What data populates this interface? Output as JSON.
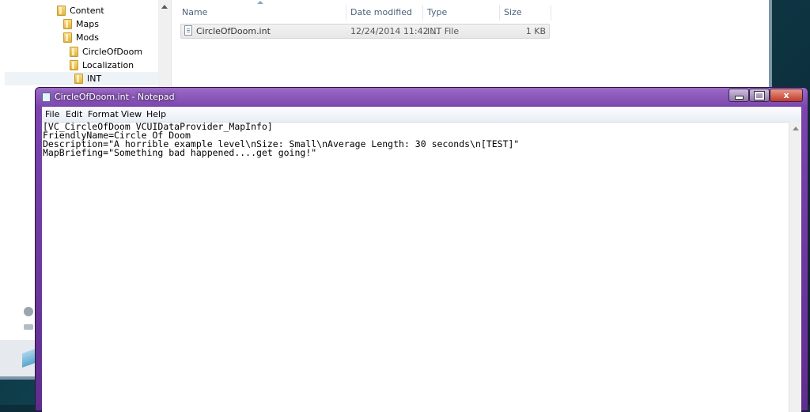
{
  "explorer": {
    "tree": [
      {
        "label": "Content",
        "indent": 0
      },
      {
        "label": "Maps",
        "indent": 1
      },
      {
        "label": "Mods",
        "indent": 1
      },
      {
        "label": "CircleOfDoom",
        "indent": 2
      },
      {
        "label": "Localization",
        "indent": 2
      },
      {
        "label": "INT",
        "indent": 3
      }
    ],
    "columns": {
      "name": "Name",
      "date_modified": "Date modified",
      "type": "Type",
      "size": "Size"
    },
    "file": {
      "name": "CircleOfDoom.int",
      "date_modified": "12/24/2014 11:42 ...",
      "type": "INT File",
      "size": "1 KB"
    }
  },
  "notepad": {
    "title": "CircleOfDoom.int - Notepad",
    "menu": [
      "File",
      "Edit",
      "Format",
      "View",
      "Help"
    ],
    "caption_buttons": {
      "minimize": "minimize",
      "maximize": "maximize",
      "close": "x"
    },
    "text_lines": [
      "[VC_CircleOfDoom VCUIDataProvider_MapInfo]",
      "FriendlyName=Circle Of Doom",
      "Description=\"A horrible example level\\nSize: Small\\nAverage Length: 30 seconds\\n[TEST]\"",
      "MapBriefing=\"Something bad happened....get going!\""
    ]
  },
  "colors": {
    "notepad_frame": "#7b45ad",
    "close_button": "#c0392b",
    "column_header_text": "#4c607a"
  }
}
